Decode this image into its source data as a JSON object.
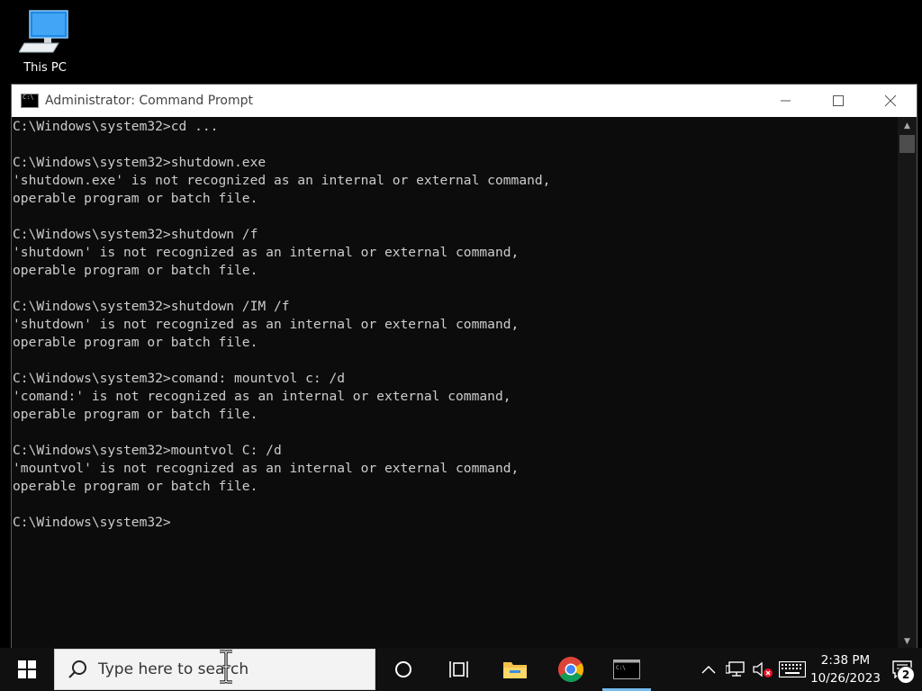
{
  "desktop": {
    "icons": [
      {
        "label": "This PC",
        "icon": "this-pc-icon"
      }
    ]
  },
  "window": {
    "title": "Administrator: Command Prompt",
    "icon": "command-prompt-icon",
    "console_lines": [
      "C:\\Windows\\system32>cd ...",
      "",
      "C:\\Windows\\system32>shutdown.exe",
      "'shutdown.exe' is not recognized as an internal or external command,",
      "operable program or batch file.",
      "",
      "C:\\Windows\\system32>shutdown /f",
      "'shutdown' is not recognized as an internal or external command,",
      "operable program or batch file.",
      "",
      "C:\\Windows\\system32>shutdown /IM /f",
      "'shutdown' is not recognized as an internal or external command,",
      "operable program or batch file.",
      "",
      "C:\\Windows\\system32>comand: mountvol c: /d",
      "'comand:' is not recognized as an internal or external command,",
      "operable program or batch file.",
      "",
      "C:\\Windows\\system32>mountvol C: /d",
      "'mountvol' is not recognized as an internal or external command,",
      "operable program or batch file.",
      "",
      "C:\\Windows\\system32>"
    ],
    "colors": {
      "background": "#0c0c0c",
      "text": "#cccccc",
      "titlebar": "#ffffff"
    }
  },
  "taskbar": {
    "search_placeholder": "Type here to search",
    "pinned": [
      {
        "name": "cortana",
        "icon": "cortana-circle-icon"
      },
      {
        "name": "task-view",
        "icon": "task-view-icon"
      },
      {
        "name": "file-explorer",
        "icon": "folder-icon"
      },
      {
        "name": "chrome",
        "icon": "chrome-icon"
      },
      {
        "name": "command-prompt",
        "icon": "command-prompt-icon",
        "active": true
      }
    ],
    "tray": {
      "icons": [
        "chevron-up-icon",
        "network-icon",
        "volume-muted-icon",
        "keyboard-icon"
      ],
      "time": "2:38 PM",
      "date": "10/26/2023",
      "notification_count": "2"
    },
    "colors": {
      "background": "#101010",
      "active_indicator": "#76b9ed"
    }
  }
}
